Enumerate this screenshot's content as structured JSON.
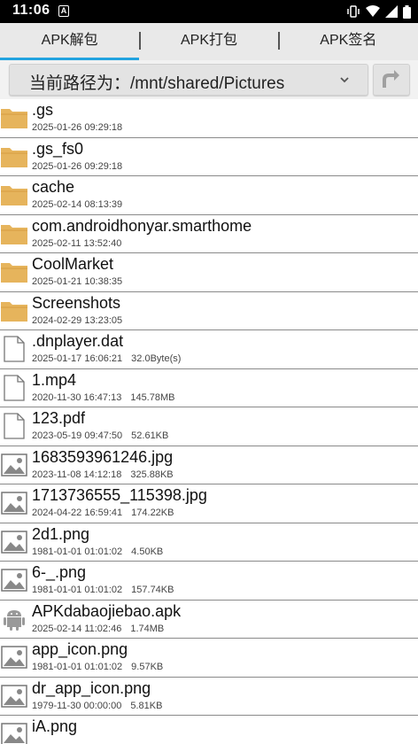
{
  "status_bar": {
    "time": "11:06",
    "notification_letter": "A"
  },
  "tabs": [
    {
      "label": "APK解包",
      "active": true
    },
    {
      "label": "APK打包",
      "active": false
    },
    {
      "label": "APK签名",
      "active": false
    }
  ],
  "path": {
    "text": "当前路径为：/mnt/shared/Pictures"
  },
  "colors": {
    "accent": "#22a3e0",
    "folder": "#e6b45c"
  },
  "files": [
    {
      "type": "folder",
      "icon": "folder-icon",
      "name": ".gs",
      "date": "2025-01-26 09:29:18",
      "size": ""
    },
    {
      "type": "folder",
      "icon": "folder-icon",
      "name": ".gs_fs0",
      "date": "2025-01-26 09:29:18",
      "size": ""
    },
    {
      "type": "folder",
      "icon": "folder-icon",
      "name": "cache",
      "date": "2025-02-14 08:13:39",
      "size": ""
    },
    {
      "type": "folder",
      "icon": "folder-icon",
      "name": "com.androidhonyar.smarthome",
      "date": "2025-02-11 13:52:40",
      "size": ""
    },
    {
      "type": "folder",
      "icon": "folder-icon",
      "name": "CoolMarket",
      "date": "2025-01-21 10:38:35",
      "size": ""
    },
    {
      "type": "folder",
      "icon": "folder-icon",
      "name": "Screenshots",
      "date": "2024-02-29 13:23:05",
      "size": ""
    },
    {
      "type": "file",
      "icon": "file-icon",
      "name": ".dnplayer.dat",
      "date": "2025-01-17 16:06:21",
      "size": "32.0Byte(s)"
    },
    {
      "type": "file",
      "icon": "file-icon",
      "name": "1.mp4",
      "date": "2020-11-30 16:47:13",
      "size": "145.78MB"
    },
    {
      "type": "file",
      "icon": "file-icon",
      "name": "123.pdf",
      "date": "2023-05-19 09:47:50",
      "size": "52.61KB"
    },
    {
      "type": "image",
      "icon": "image-icon",
      "name": "1683593961246.jpg",
      "date": "2023-11-08 14:12:18",
      "size": "325.88KB"
    },
    {
      "type": "image",
      "icon": "image-icon",
      "name": "1713736555_115398.jpg",
      "date": "2024-04-22 16:59:41",
      "size": "174.22KB"
    },
    {
      "type": "image",
      "icon": "image-icon",
      "name": "2d1.png",
      "date": "1981-01-01 01:01:02",
      "size": "4.50KB"
    },
    {
      "type": "image",
      "icon": "image-icon",
      "name": "6-_.png",
      "date": "1981-01-01 01:01:02",
      "size": "157.74KB"
    },
    {
      "type": "apk",
      "icon": "android-icon",
      "name": "APKdabaojiebao.apk",
      "date": "2025-02-14 11:02:46",
      "size": "1.74MB"
    },
    {
      "type": "image",
      "icon": "image-icon",
      "name": "app_icon.png",
      "date": "1981-01-01 01:01:02",
      "size": "9.57KB"
    },
    {
      "type": "image",
      "icon": "image-icon",
      "name": "dr_app_icon.png",
      "date": "1979-11-30 00:00:00",
      "size": "5.81KB"
    },
    {
      "type": "image",
      "icon": "image-icon",
      "name": "iA.png",
      "date": "",
      "size": ""
    }
  ]
}
